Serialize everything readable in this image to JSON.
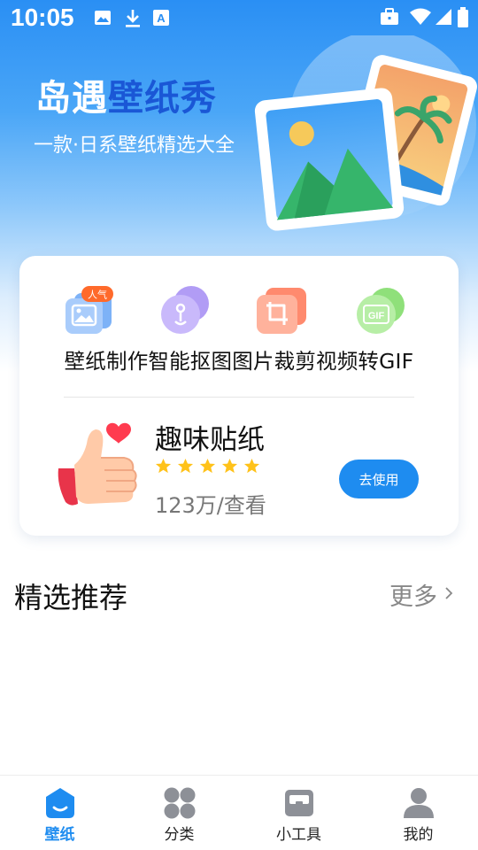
{
  "status_bar": {
    "time": "10:05",
    "icons_left": [
      "image-icon",
      "download-icon",
      "font-icon"
    ],
    "icons_right": [
      "briefcase-icon",
      "wifi-icon",
      "signal-icon",
      "battery-icon"
    ]
  },
  "hero": {
    "title_part1": "岛遇",
    "title_part2": "壁纸秀",
    "subtitle": "一款·日系壁纸精选大全",
    "accent_color": "#1a57d6"
  },
  "tools": {
    "items": [
      {
        "label": "壁纸制作",
        "badge": "人气",
        "icon": "wallpaper-make-icon"
      },
      {
        "label": "智能抠图",
        "icon": "smart-cutout-icon"
      },
      {
        "label": "图片裁剪",
        "icon": "crop-icon"
      },
      {
        "label": "视频转GIF",
        "icon": "gif-icon",
        "icon_text": "GIF"
      }
    ]
  },
  "sticker": {
    "title": "趣味贴纸",
    "rating": 5,
    "meta": "123万/查看",
    "button_label": "去使用",
    "button_color": "#1e8cf0"
  },
  "section": {
    "title": "精选推荐",
    "more_label": "更多"
  },
  "tab_bar": {
    "active_color": "#1e8cf0",
    "items": [
      {
        "label": "壁纸",
        "icon": "wallpaper-tab-icon",
        "active": true
      },
      {
        "label": "分类",
        "icon": "category-tab-icon",
        "active": false
      },
      {
        "label": "小工具",
        "icon": "tools-tab-icon",
        "active": false
      },
      {
        "label": "我的",
        "icon": "profile-tab-icon",
        "active": false
      }
    ]
  }
}
